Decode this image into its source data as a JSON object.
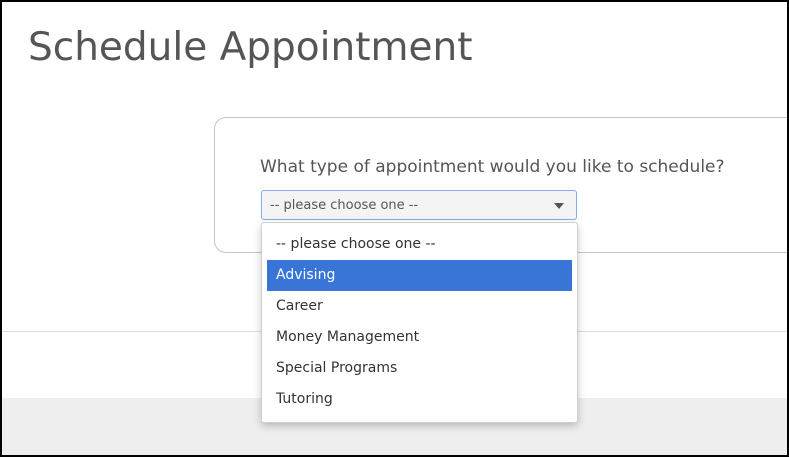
{
  "page": {
    "title": "Schedule Appointment"
  },
  "form": {
    "question": "What type of appointment would you like to schedule?",
    "select": {
      "selected_value": "-- please choose one --",
      "options": [
        {
          "label": "-- please choose one --"
        },
        {
          "label": "Advising",
          "highlighted": true
        },
        {
          "label": "Career"
        },
        {
          "label": "Money Management"
        },
        {
          "label": "Special Programs"
        },
        {
          "label": "Tutoring"
        }
      ]
    }
  },
  "colors": {
    "highlight": "#3875d7",
    "text": "#555555",
    "select_border": "#86aee8"
  },
  "icons": {
    "select_caret": "chevron-down-icon"
  }
}
